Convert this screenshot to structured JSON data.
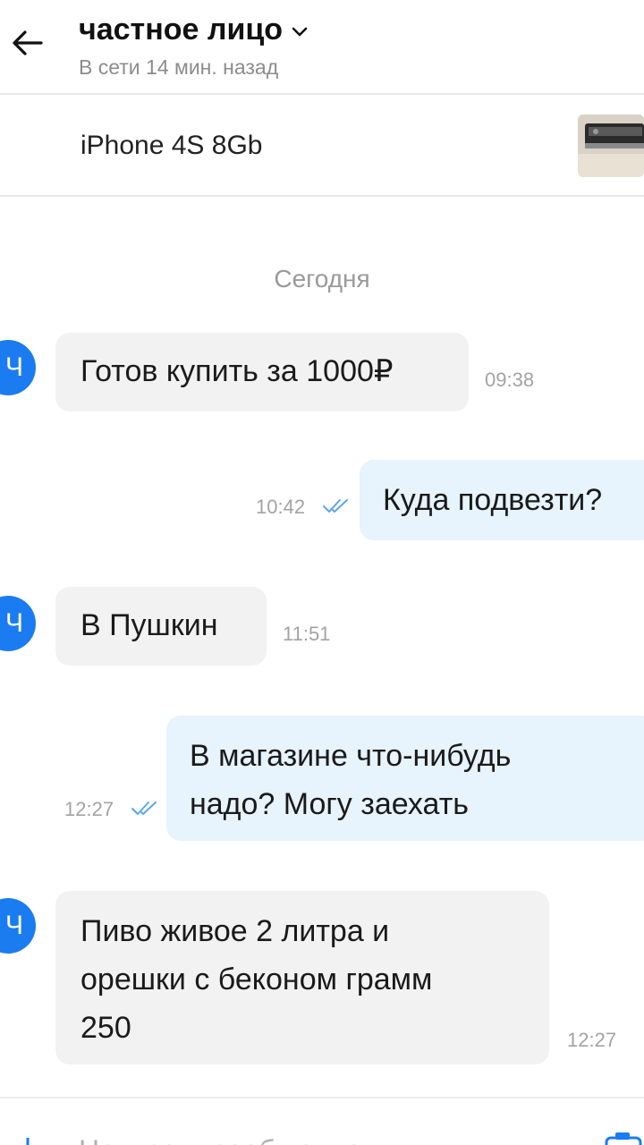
{
  "header": {
    "title": "частное лицо",
    "subtitle": "В сети 14 мин. назад"
  },
  "listing": {
    "title": "iPhone 4S 8Gb"
  },
  "date_separator": "Сегодня",
  "avatar_initial": "Ч",
  "messages": [
    {
      "direction": "in",
      "text": "Готов купить за 1000₽",
      "time": "09:38"
    },
    {
      "direction": "out",
      "text": "Куда подвезти?",
      "time": "10:42",
      "status": "read"
    },
    {
      "direction": "in",
      "text": "В Пушкин",
      "time": "11:51"
    },
    {
      "direction": "out",
      "lines": [
        "В магазине что-нибудь",
        "надо? Могу заехать"
      ],
      "time": "12:27",
      "status": "read"
    },
    {
      "direction": "in",
      "lines": [
        "Пиво живое 2 литра и",
        "орешки с беконом грамм",
        "250"
      ],
      "time": "12:27"
    }
  ],
  "composer": {
    "placeholder": "Написать сообщение"
  },
  "colors": {
    "accent": "#1a7cf0",
    "incoming_bubble": "#f2f2f2",
    "outgoing_bubble": "#e7f3fd",
    "tick": "#5aa7e8"
  }
}
